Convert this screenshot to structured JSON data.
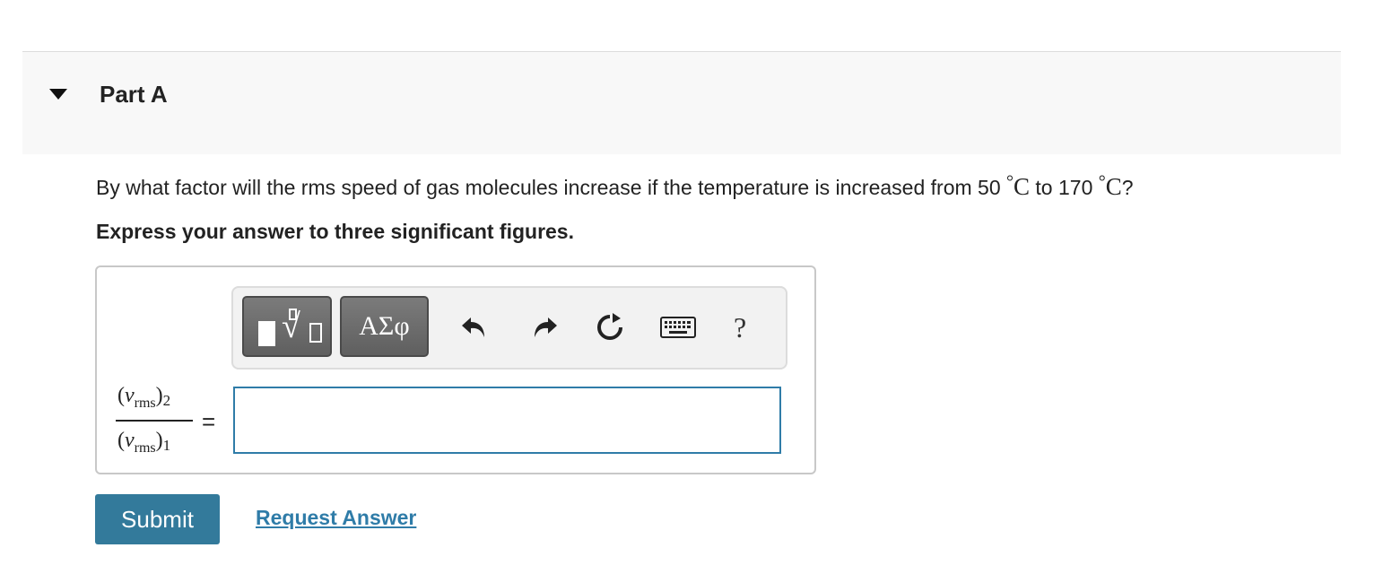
{
  "part": {
    "title": "Part A",
    "toggle_icon": "caret-down-icon"
  },
  "question": {
    "text_before": "By what factor will the rms speed of gas molecules increase if the temperature is increased from 50",
    "deg1": "°",
    "unit1": "C",
    "text_mid": " to 170",
    "deg2": "°",
    "unit2": "C",
    "text_end": "?"
  },
  "instruction": "Express your answer to three significant figures.",
  "toolbar": {
    "templates_icon": "templates-icon",
    "symbols_label": "ΑΣφ",
    "undo_icon": "undo-icon",
    "redo_icon": "redo-icon",
    "reset_icon": "reset-icon",
    "keyboard_icon": "keyboard-icon",
    "help_label": "?"
  },
  "equation": {
    "numerator_var": "v",
    "numerator_sub": "rms",
    "numerator_index": "2",
    "denominator_var": "v",
    "denominator_sub": "rms",
    "denominator_index": "1",
    "open_paren": "(",
    "close_paren": ")",
    "equals": "="
  },
  "answer": {
    "value": "",
    "placeholder": ""
  },
  "actions": {
    "submit_label": "Submit",
    "request_answer_label": "Request Answer"
  },
  "colors": {
    "accent": "#337a9b",
    "link": "#2f7ca8",
    "header_bg": "#f8f8f8"
  }
}
